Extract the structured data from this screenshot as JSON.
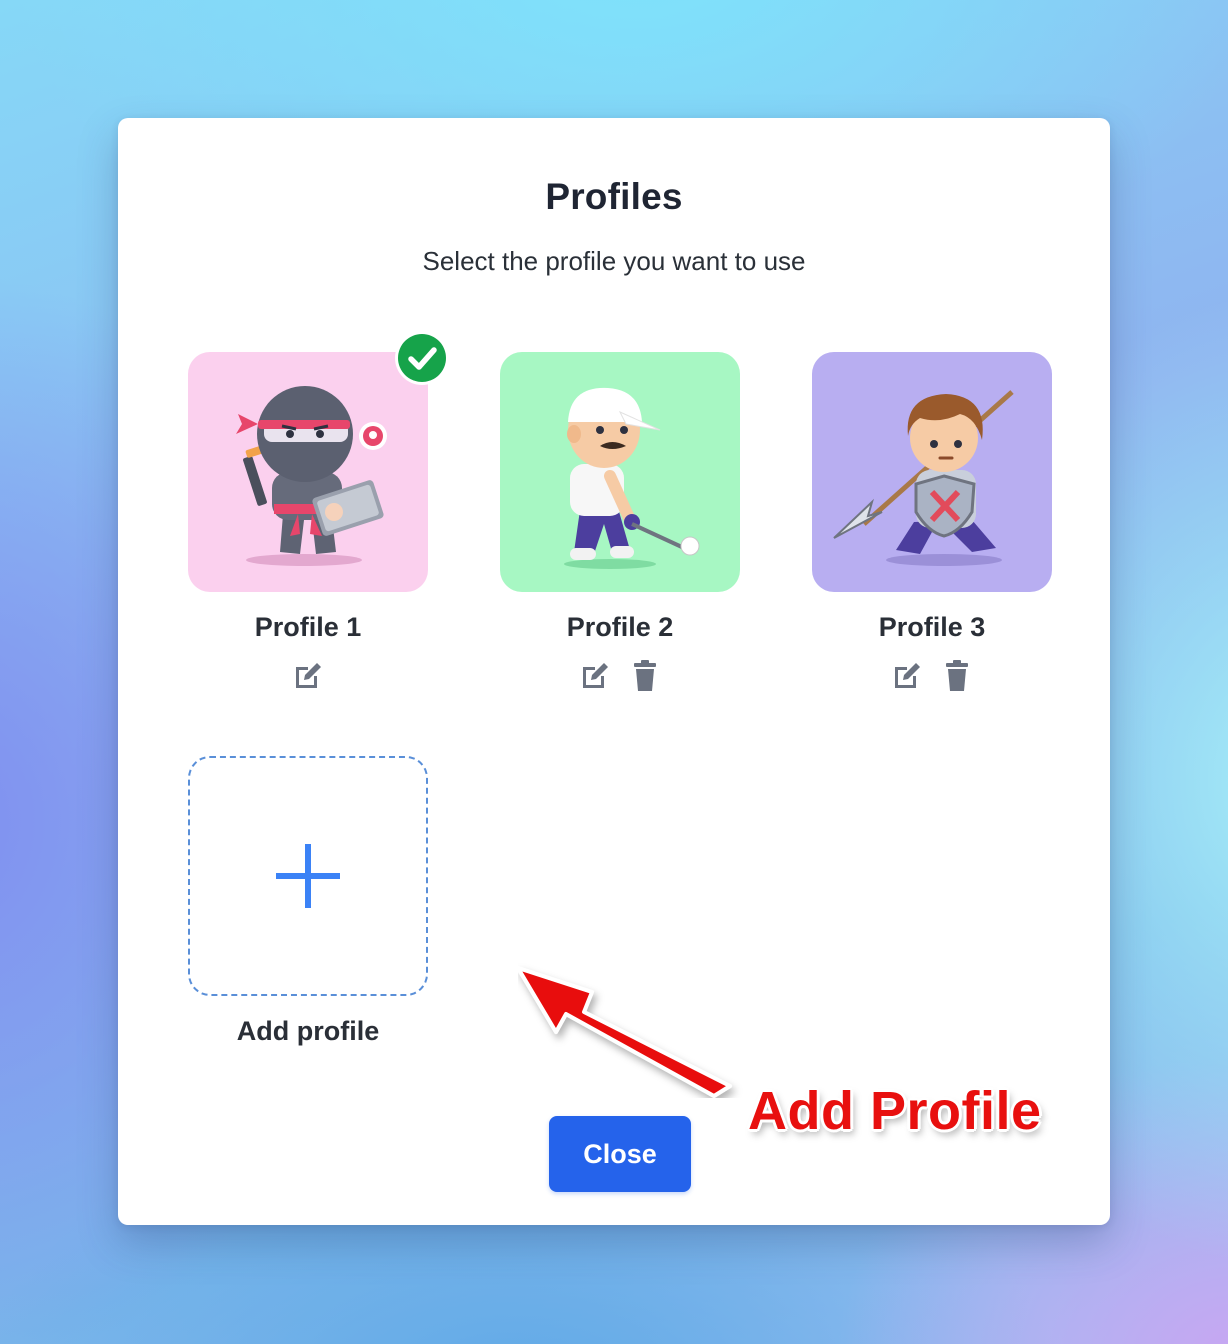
{
  "modal": {
    "title": "Profiles",
    "subtitle": "Select the profile you want to use",
    "close_label": "Close"
  },
  "profiles": [
    {
      "name": "Profile 1",
      "avatar": "ninja-with-laptop-avatar",
      "bg_color": "#fbd0ee",
      "selected": true,
      "actions": [
        "edit-icon"
      ]
    },
    {
      "name": "Profile 2",
      "avatar": "golfer-avatar",
      "bg_color": "#a7f7c3",
      "selected": false,
      "actions": [
        "edit-icon",
        "trash-icon"
      ]
    },
    {
      "name": "Profile 3",
      "avatar": "knight-with-spear-avatar",
      "bg_color": "#b8aef1",
      "selected": false,
      "actions": [
        "edit-icon",
        "trash-icon"
      ]
    }
  ],
  "add_profile": {
    "label": "Add profile",
    "icon": "plus-icon"
  },
  "annotation": {
    "text": "Add Profile",
    "color": "#e8100f"
  },
  "colors": {
    "primary": "#2563eb",
    "selected_check": "#16a34a",
    "icon_gray": "#6b7280"
  }
}
